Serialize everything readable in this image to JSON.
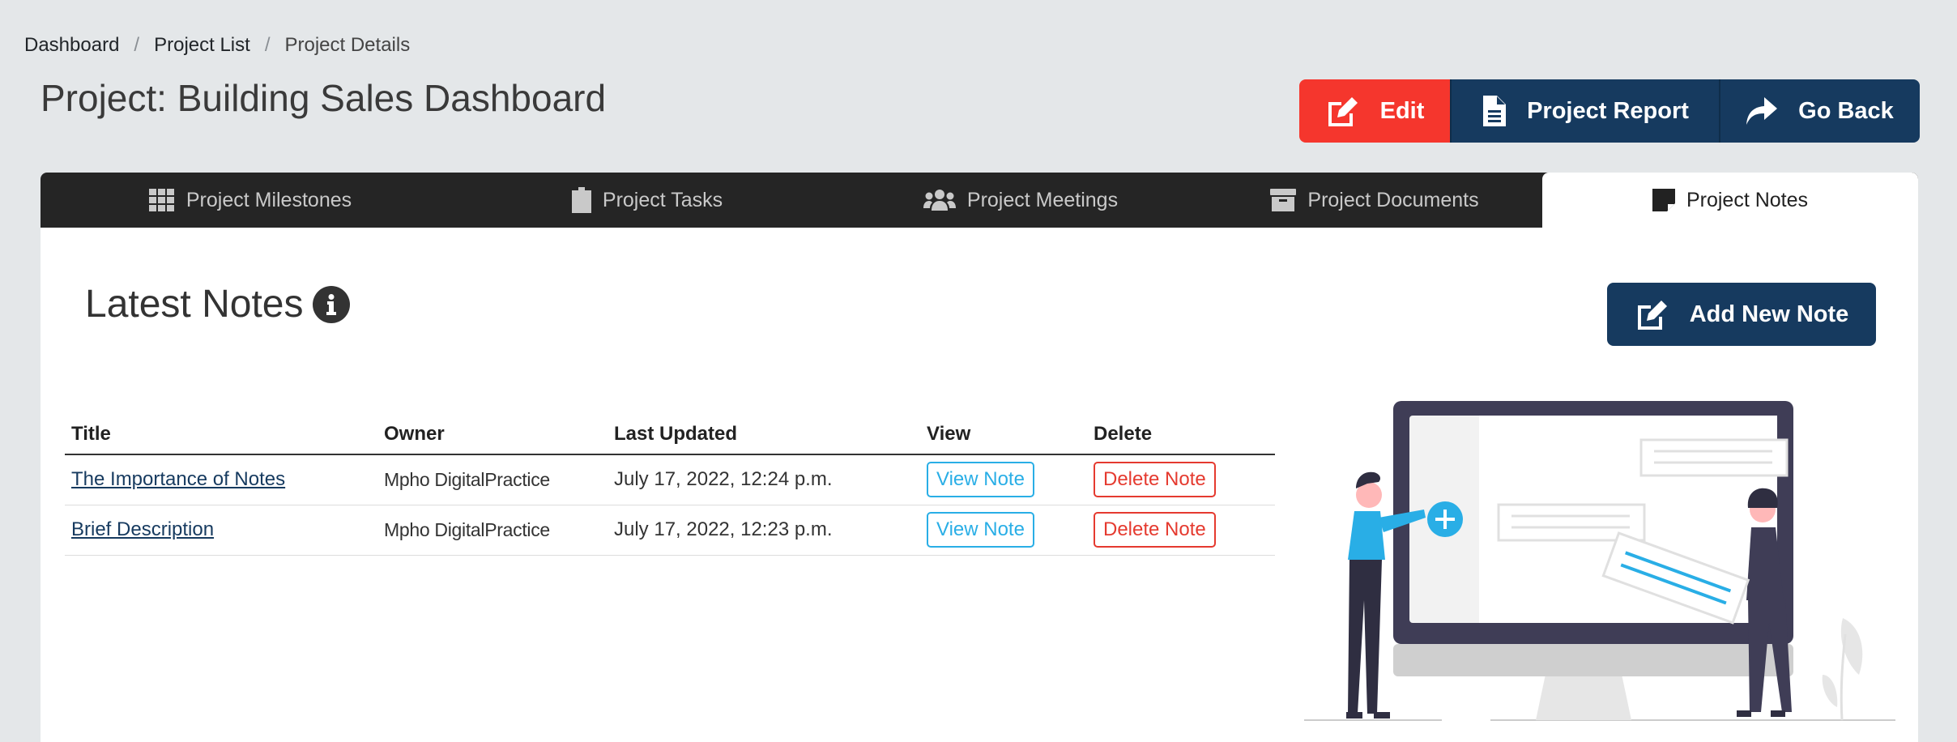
{
  "breadcrumb": {
    "items": [
      "Dashboard",
      "Project List",
      "Project Details"
    ],
    "separator": "/"
  },
  "page_title": "Project: Building Sales Dashboard",
  "actions": {
    "edit": "Edit",
    "report": "Project Report",
    "back": "Go Back"
  },
  "tabs": [
    {
      "label": "Project Milestones",
      "icon": "grid-icon"
    },
    {
      "label": "Project Tasks",
      "icon": "clipboard-icon"
    },
    {
      "label": "Project Meetings",
      "icon": "users-icon"
    },
    {
      "label": "Project Documents",
      "icon": "archive-icon"
    },
    {
      "label": "Project Notes",
      "icon": "sticky-note-icon",
      "active": true
    }
  ],
  "section": {
    "title": "Latest Notes",
    "add_button": "Add New Note"
  },
  "table": {
    "headers": {
      "title": "Title",
      "owner": "Owner",
      "updated": "Last Updated",
      "view": "View",
      "delete": "Delete"
    },
    "rows": [
      {
        "title": "The Importance of Notes",
        "owner": "Mpho DigitalPractice",
        "updated": "July 17, 2022, 12:24 p.m.",
        "view": "View Note",
        "delete": "Delete Note"
      },
      {
        "title": "Brief Description",
        "owner": "Mpho DigitalPractice",
        "updated": "July 17, 2022, 12:23 p.m.",
        "view": "View Note",
        "delete": "Delete Note"
      }
    ]
  },
  "colors": {
    "background": "#e4e7e9",
    "primary": "#163a5f",
    "danger": "#f5362d",
    "info": "#29aee6",
    "tabbar": "#252525"
  }
}
